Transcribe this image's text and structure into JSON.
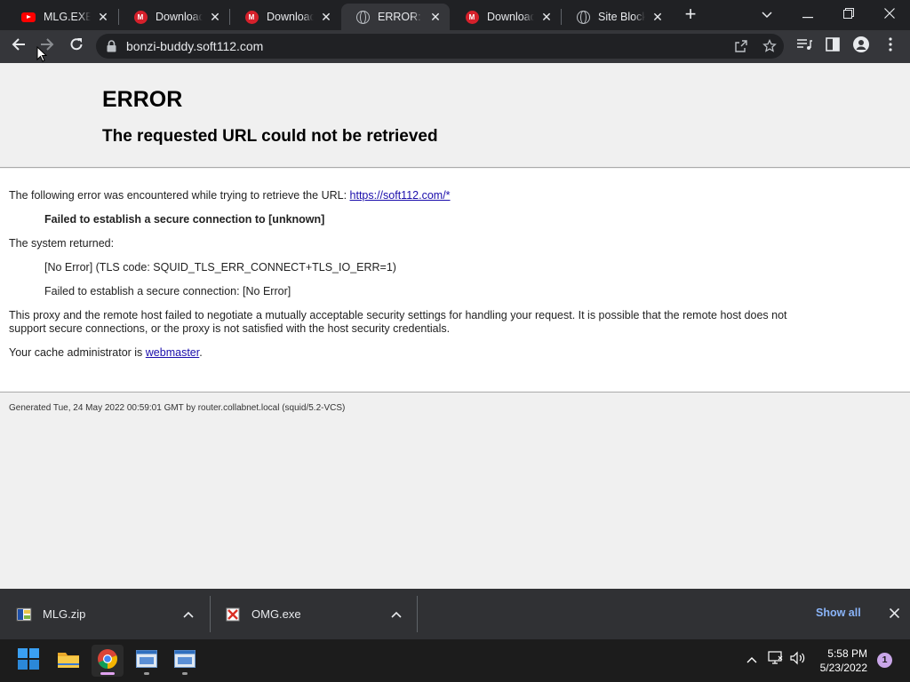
{
  "browser": {
    "tabs": [
      {
        "title": "MLG.EXE - YouTube",
        "favicon": "youtube-icon",
        "active": false
      },
      {
        "title": "Download MLG",
        "favicon": "mega-icon",
        "active": false
      },
      {
        "title": "Download OMG",
        "favicon": "mega-icon",
        "active": false
      },
      {
        "title": "ERROR: The requested URL",
        "favicon": "globe-icon",
        "active": true
      },
      {
        "title": "Download",
        "favicon": "mega-icon",
        "active": false
      },
      {
        "title": "Site Blocked",
        "favicon": "globe-icon",
        "active": false
      }
    ],
    "new_tab_label": "+",
    "url": "bonzi-buddy.soft112.com"
  },
  "page": {
    "title": "ERROR",
    "subtitle": "The requested URL could not be retrieved",
    "intro_text": "The following error was encountered while trying to retrieve the URL: ",
    "intro_link": "https://soft112.com/*",
    "error_main": "Failed to establish a secure connection to [unknown]",
    "system_returned": "The system returned:",
    "tls_code": "[No Error] (TLS code: SQUID_TLS_ERR_CONNECT+TLS_IO_ERR=1)",
    "secure_fail": "Failed to establish a secure connection: [No Error]",
    "description_line1": "This proxy and the remote host failed to negotiate a mutually acceptable security settings for handling your request. It is possible that the remote host does not",
    "description_line2": "support secure connections, or the proxy is not satisfied with the host security credentials.",
    "admin_prefix": "Your cache administrator is ",
    "admin_link": "webmaster",
    "admin_suffix": ".",
    "footer": "Generated Tue, 24 May 2022 00:59:01 GMT by router.collabnet.local (squid/5.2-VCS)"
  },
  "downloads": {
    "items": [
      {
        "name": "MLG.zip",
        "icon": "zip-archive-icon"
      },
      {
        "name": "OMG.exe",
        "icon": "blocked-exe-icon"
      }
    ],
    "show_all": "Show all"
  },
  "taskbar": {
    "time": "5:58 PM",
    "date": "5/23/2022",
    "notification_count": "1",
    "apps": [
      "windows-start-icon",
      "file-explorer-icon",
      "chrome-icon",
      "app-window-icon",
      "app-window-icon"
    ]
  },
  "colors": {
    "tab_strip": "#202124",
    "toolbar": "#35363a",
    "link": "#1a0dab",
    "show_all": "#8ab4f8",
    "taskbar": "#1c1c1c"
  }
}
